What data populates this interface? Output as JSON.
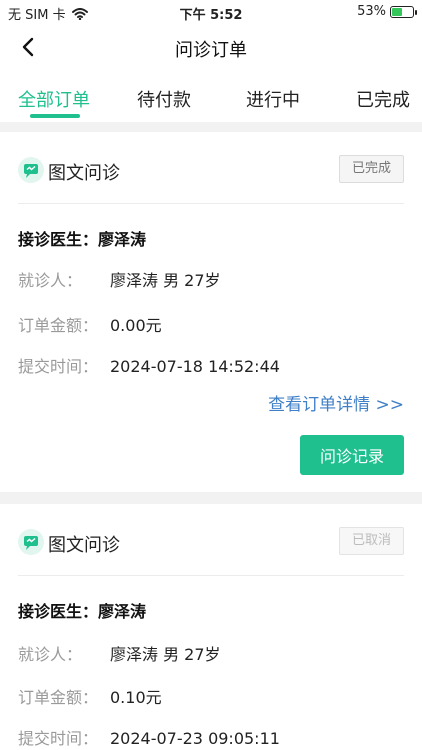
{
  "status_bar": {
    "carrier": "无 SIM 卡",
    "time": "下午 5:52",
    "battery": "53%",
    "battery_level": 0.53
  },
  "nav": {
    "title": "问诊订单"
  },
  "tabs": [
    {
      "label": "全部订单",
      "active": true
    },
    {
      "label": "待付款",
      "active": false
    },
    {
      "label": "进行中",
      "active": false
    },
    {
      "label": "已完成",
      "active": false
    }
  ],
  "orders": [
    {
      "service": "图文问诊",
      "status": "已完成",
      "doctor": "接诊医生：廖泽涛",
      "patient_label": "就诊人：",
      "patient_value": "廖泽涛   男   27岁",
      "amount_label": "订单金额：",
      "amount_value": "0.00元",
      "time_label": "提交时间：",
      "time_value": "2024-07-18 14:52:44",
      "detail_link": "查看订单详情 >>",
      "record_button": "问诊记录"
    },
    {
      "service": "图文问诊",
      "status": "已取消",
      "doctor": "接诊医生：廖泽涛",
      "patient_label": "就诊人：",
      "patient_value": "廖泽涛   男   27岁",
      "amount_label": "订单金额：",
      "amount_value": "0.10元",
      "time_label": "提交时间：",
      "time_value": "2024-07-23 09:05:11"
    }
  ]
}
